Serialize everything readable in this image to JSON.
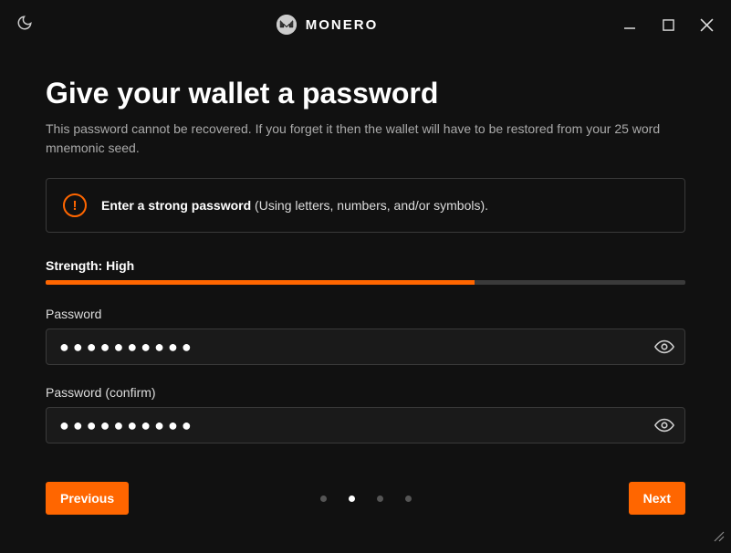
{
  "brand": "MONERO",
  "header": {
    "title": "Give your wallet a password",
    "subtitle": "This password cannot be recovered. If you forget it then the wallet will have to be restored from your 25 word mnemonic seed."
  },
  "hint": {
    "bold": "Enter a strong password",
    "rest": " (Using letters, numbers, and/or symbols)."
  },
  "strength": {
    "label": "Strength: High",
    "percent": 67,
    "color": "#ff6600"
  },
  "fields": {
    "password_label": "Password",
    "password_value": "●●●●●●●●●●",
    "confirm_label": "Password (confirm)",
    "confirm_value": "●●●●●●●●●●"
  },
  "buttons": {
    "previous": "Previous",
    "next": "Next"
  },
  "wizard": {
    "step_count": 4,
    "active_index": 1
  }
}
